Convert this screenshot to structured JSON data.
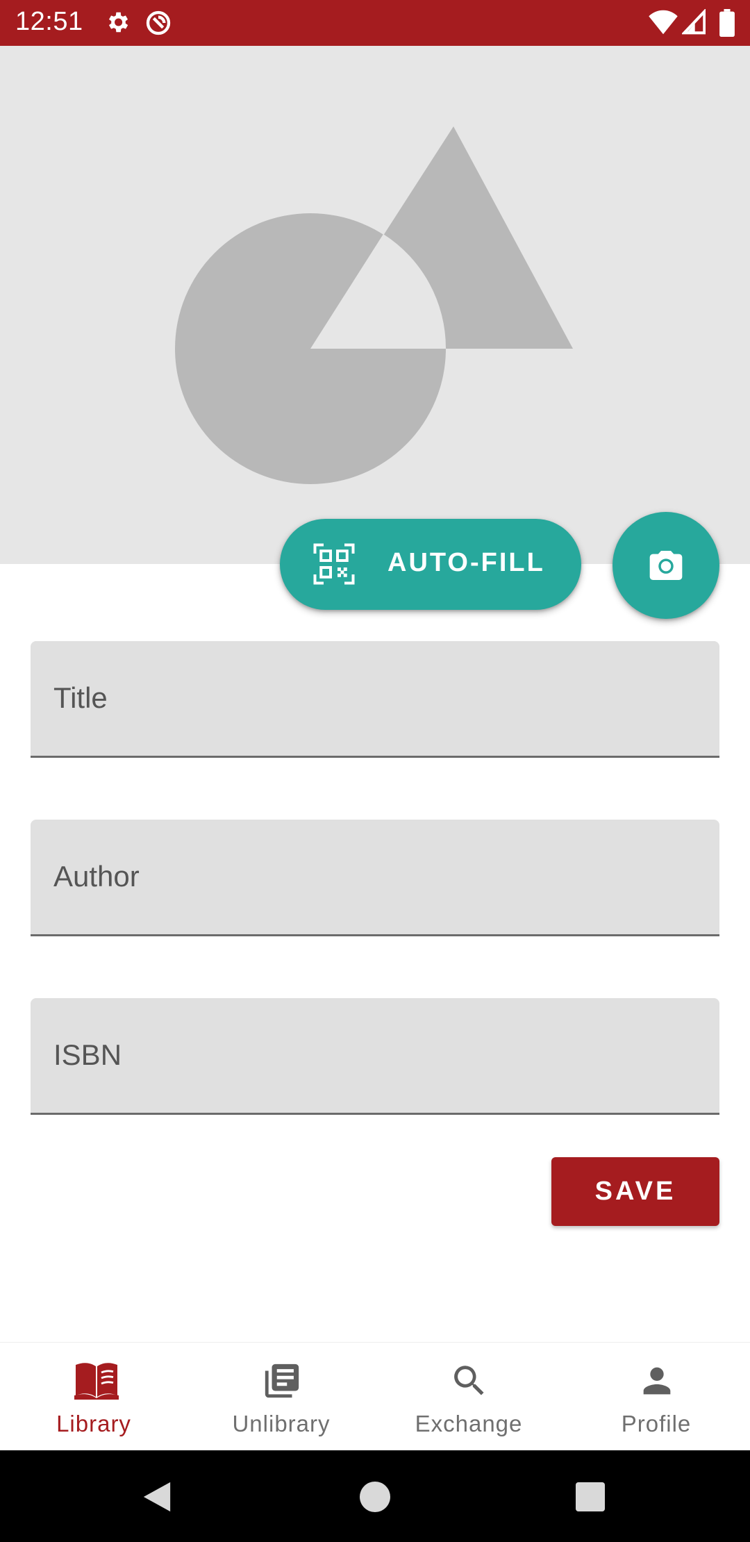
{
  "status_bar": {
    "time": "12:51",
    "icons": [
      "gear-icon",
      "sync-icon",
      "wifi-icon",
      "signal-icon",
      "battery-icon"
    ]
  },
  "cover": {
    "icon": "image-placeholder-icon"
  },
  "actions": {
    "autofill_label": "AUTO-FILL",
    "autofill_icon": "qr-code-scan-icon",
    "camera_icon": "camera-icon"
  },
  "form": {
    "title_label": "Title",
    "title_value": "",
    "author_label": "Author",
    "author_value": "",
    "isbn_label": "ISBN",
    "isbn_value": "",
    "save_label": "SAVE"
  },
  "bottom_nav": {
    "items": [
      {
        "label": "Library",
        "icon": "open-book-icon",
        "active": true
      },
      {
        "label": "Unlibrary",
        "icon": "library-books-icon",
        "active": false
      },
      {
        "label": "Exchange",
        "icon": "search-icon",
        "active": false
      },
      {
        "label": "Profile",
        "icon": "person-icon",
        "active": false
      }
    ]
  },
  "system_nav": {
    "icons": [
      "back-icon",
      "home-icon",
      "recents-icon"
    ]
  },
  "colors": {
    "primary": "#a51c1f",
    "accent": "#27a89c",
    "field_bg": "#e0e0e0",
    "cover_bg": "#e6e6e6"
  }
}
